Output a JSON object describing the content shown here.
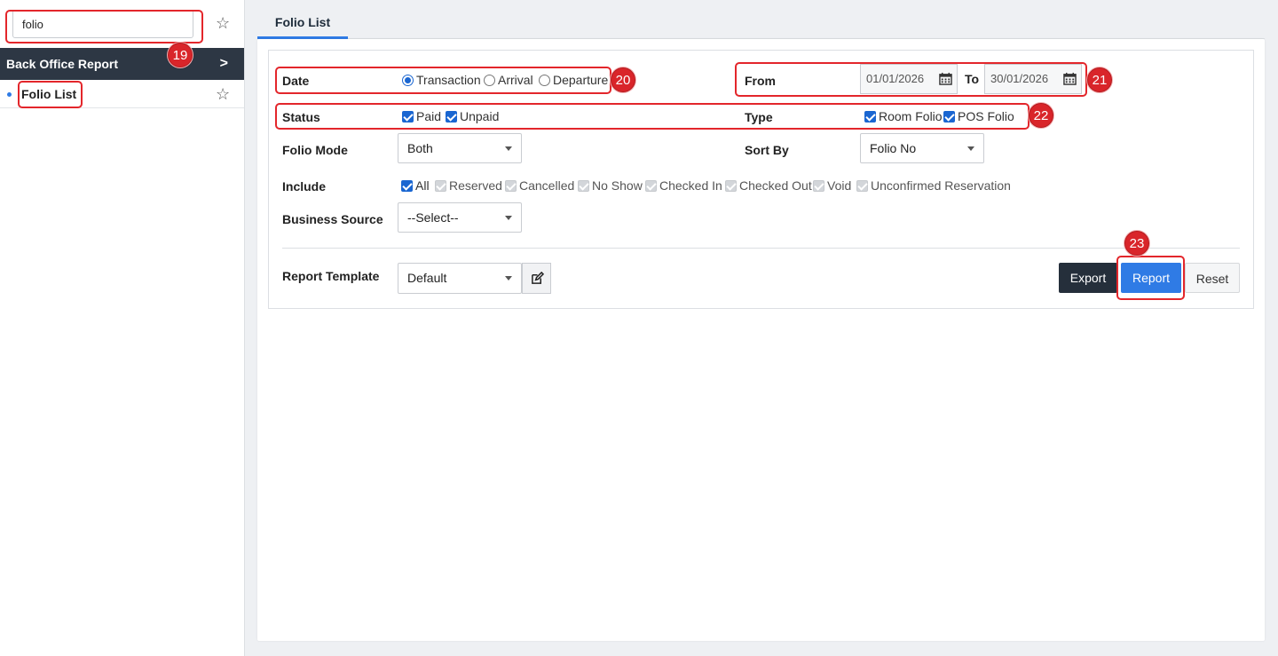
{
  "sidebar": {
    "search_value": "folio",
    "group_label": "Back Office Report",
    "item_label": "Folio List"
  },
  "tab": {
    "label": "Folio List"
  },
  "form": {
    "date": {
      "label": "Date",
      "options": [
        "Transaction",
        "Arrival",
        "Departure"
      ],
      "selected": "Transaction"
    },
    "range": {
      "from_label": "From",
      "from_value": "01/01/2026",
      "to_label": "To",
      "to_value": "30/01/2026"
    },
    "status": {
      "label": "Status",
      "options": [
        {
          "label": "Paid",
          "checked": true
        },
        {
          "label": "Unpaid",
          "checked": true
        }
      ]
    },
    "type": {
      "label": "Type",
      "options": [
        {
          "label": "Room Folio",
          "checked": true
        },
        {
          "label": "POS Folio",
          "checked": true
        }
      ]
    },
    "folio_mode": {
      "label": "Folio Mode",
      "value": "Both"
    },
    "sort_by": {
      "label": "Sort By",
      "value": "Folio No"
    },
    "include": {
      "label": "Include",
      "options": [
        {
          "label": "All",
          "checked": true,
          "enabled": true
        },
        {
          "label": "Reserved",
          "checked": true,
          "enabled": false
        },
        {
          "label": "Cancelled",
          "checked": true,
          "enabled": false
        },
        {
          "label": "No Show",
          "checked": true,
          "enabled": false
        },
        {
          "label": "Checked In",
          "checked": true,
          "enabled": false
        },
        {
          "label": "Checked Out",
          "checked": true,
          "enabled": false
        },
        {
          "label": "Void",
          "checked": true,
          "enabled": false
        },
        {
          "label": "Unconfirmed Reservation",
          "checked": true,
          "enabled": false
        }
      ]
    },
    "business_source": {
      "label": "Business Source",
      "value": "--Select--"
    },
    "report_template": {
      "label": "Report Template",
      "value": "Default"
    }
  },
  "buttons": {
    "export": "Export",
    "report": "Report",
    "reset": "Reset"
  },
  "annotations": [
    "19",
    "20",
    "21",
    "22",
    "23"
  ],
  "colors": {
    "accent": "#2f7be5",
    "dark": "#2d3744",
    "annotation": "#e3262b"
  },
  "icons": [
    "star-icon",
    "chevron-right-icon",
    "calendar-icon",
    "edit-icon",
    "caret-down-icon"
  ]
}
